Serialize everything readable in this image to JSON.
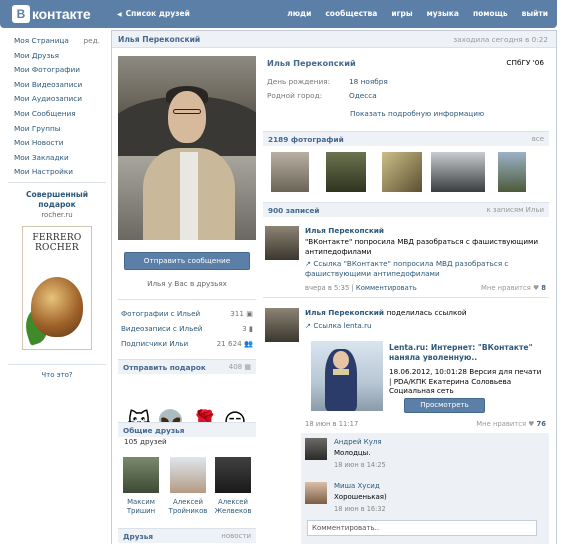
{
  "header": {
    "logo_mark": "B",
    "logo_text": "контакте",
    "back_label": "Список друзей",
    "nav": [
      "люди",
      "сообщества",
      "игры",
      "музыка",
      "помощь",
      "выйти"
    ]
  },
  "sidebar": {
    "items": [
      {
        "label": "Моя Страница",
        "extra": "ред."
      },
      {
        "label": "Мои Друзья"
      },
      {
        "label": "Мои Фотографии"
      },
      {
        "label": "Мои Видеозаписи"
      },
      {
        "label": "Мои Аудиозаписи"
      },
      {
        "label": "Мои Сообщения"
      },
      {
        "label": "Мои Группы"
      },
      {
        "label": "Мои Новости"
      },
      {
        "label": "Мои Закладки"
      },
      {
        "label": "Мои Настройки"
      }
    ],
    "ad": {
      "title": "Совершенный подарок",
      "domain": "rocher.ru",
      "brand_line1": "FERRERO",
      "brand_line2": "ROCHER",
      "what_link": "Что это?"
    }
  },
  "profile": {
    "header_name": "Илья Перекопский",
    "last_online": "заходила сегодня в 0:22",
    "name": "Илья Перекопский",
    "university": "СПбГУ '06",
    "birthday_label": "День рождения:",
    "birthday_value": "18 ноября",
    "hometown_label": "Родной город:",
    "hometown_value": "Одесса",
    "more_info": "Показать подробную информацию",
    "send_message": "Отправить сообщение",
    "in_friends": "Илья у Вас в друзьях",
    "stats": [
      {
        "label": "Фотографии с Ильей",
        "count": "311"
      },
      {
        "label": "Видеозаписи с Ильей",
        "count": "3"
      },
      {
        "label": "Подписчики Ильи",
        "count": "21 624"
      }
    ],
    "gifts": {
      "title": "Отправить подарок",
      "count": "408"
    },
    "common_friends": {
      "title": "Общие друзья",
      "count_text": "105 друзей",
      "people": [
        {
          "name": "Максим Тришин"
        },
        {
          "name": "Алексей Тройников"
        },
        {
          "name": "Алексей Желвеков"
        }
      ]
    },
    "friends_section": {
      "title": "Друзья",
      "right": "новости"
    }
  },
  "photos_section": {
    "title": "2189 фотографий",
    "right": "все"
  },
  "wall": {
    "title": "900 записей",
    "right": "к записям Ильи",
    "posts": [
      {
        "author": "Илья Перекопский",
        "text": "\"ВКонтакте\" попросила МВД разобраться с фашиствующими антипедофилами",
        "link_text": "Ссылка \"ВКонтакте\" попросила МВД разобраться с фашиствующими антипедофилами",
        "time": "вчера в 5:35",
        "comment_label": "Комментировать",
        "likes_label": "Мне нравится",
        "likes": "8"
      },
      {
        "author": "Илья Перекопский",
        "action": "поделилась ссылкой",
        "link_text": "Ссылка lenta.ru",
        "ext_title": "Lenta.ru: Интернет: \"ВКонтакте\" наняла уволенную..",
        "ext_desc": "18.06.2012, 10:01:28 Версия для печати | PDA/КПК  Екатерина Соловьева Социальная сеть",
        "view_label": "Просмотреть",
        "time": "18 июн в 11:17",
        "likes_label": "Мне нравится",
        "likes": "76",
        "comments": [
          {
            "name": "Андрей Куля",
            "text": "Молодцы.",
            "time": "18 июн в 14:25"
          },
          {
            "name": "Миша Хусид",
            "text": "Хорошенькая)",
            "time": "18 июн в 16:32"
          }
        ],
        "comment_placeholder": "Комментировать.."
      }
    ]
  },
  "colors": {
    "brand_blue": "#5b7fa6",
    "link_blue": "#2b587a",
    "section_bg": "#eef1f6"
  }
}
